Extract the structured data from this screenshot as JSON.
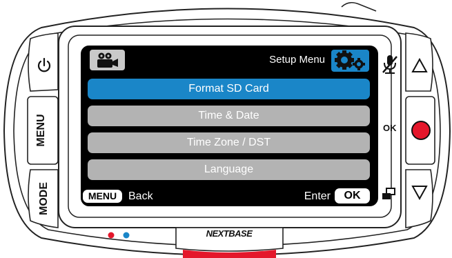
{
  "screen": {
    "title": "Setup Menu",
    "mode_icon": "video-camera-icon",
    "settings_icon": "gears-icon"
  },
  "menu": {
    "items": [
      {
        "label": "Format SD Card",
        "selected": true
      },
      {
        "label": "Time & Date",
        "selected": false
      },
      {
        "label": "Time Zone / DST",
        "selected": false
      },
      {
        "label": "Language",
        "selected": false
      }
    ]
  },
  "footer": {
    "menu_key": "MENU",
    "back_label": "Back",
    "enter_label": "Enter",
    "ok_key": "OK"
  },
  "device": {
    "left_buttons": {
      "power_icon": "power-icon",
      "menu_label": "MENU",
      "mode_label": "MODE"
    },
    "right_buttons": {
      "up_icon": "triangle-up-icon",
      "ok_label": "OK",
      "record_icon": "record-dot-icon",
      "down_icon": "triangle-down-icon",
      "mic_icon": "microphone-muted-icon",
      "protect_icon": "protect-file-icon"
    },
    "brand": "NEXTBASE",
    "colors": {
      "accent_blue": "#1a86c8",
      "menu_grey": "#b3b3b3",
      "record_red": "#e4172b",
      "led_red": "#e4172b",
      "led_blue": "#1a86c8"
    }
  }
}
